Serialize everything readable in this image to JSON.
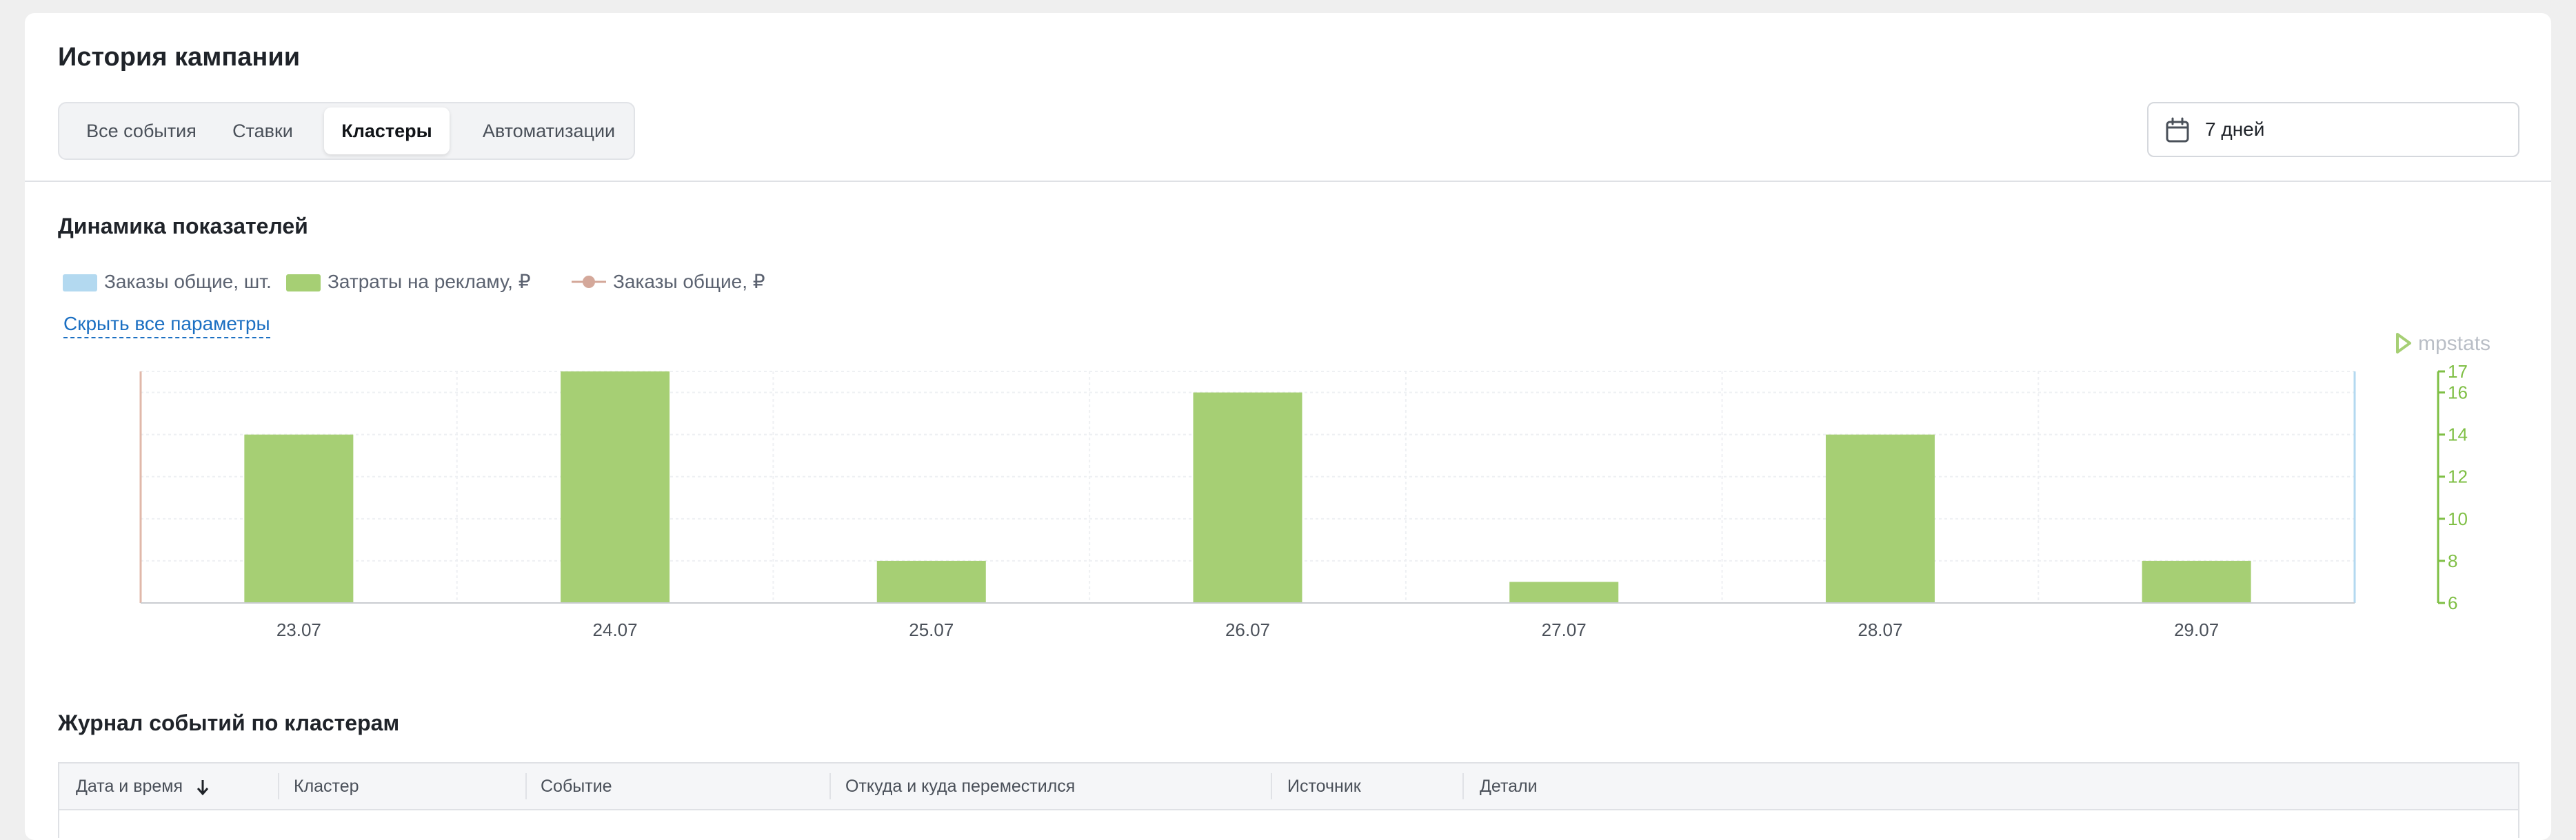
{
  "header": {
    "title": "История кампании"
  },
  "tabs": [
    {
      "label": "Все события",
      "active": false
    },
    {
      "label": "Ставки",
      "active": false
    },
    {
      "label": "Кластеры",
      "active": true
    },
    {
      "label": "Автоматизации",
      "active": false
    }
  ],
  "period": {
    "label": "7 дней"
  },
  "metrics": {
    "title": "Динамика показателей",
    "legend": [
      {
        "label": "Заказы общие, шт.",
        "color": "#b3d9f0"
      },
      {
        "label": "Затраты на рекламу, ₽",
        "color": "#a6cf74"
      },
      {
        "label": "Заказы общие, ₽",
        "color": "#d4a89a"
      }
    ],
    "hide_link": "Скрыть все параметры",
    "watermark": "mpstats"
  },
  "chart_data": {
    "type": "bar",
    "categories": [
      "23.07",
      "24.07",
      "25.07",
      "26.07",
      "27.07",
      "28.07",
      "29.07"
    ],
    "series": [
      {
        "name": "Затраты на рекламу, ₽",
        "values": [
          14,
          17,
          8,
          16,
          7,
          14,
          8
        ],
        "color": "#a6cf74",
        "axis": "right"
      }
    ],
    "y_right": {
      "min": 6,
      "max": 17,
      "ticks": [
        "17",
        "16",
        "14",
        "12",
        "10",
        "8",
        "6"
      ],
      "color": "#7fbf45"
    },
    "grid": true
  },
  "journal": {
    "title": "Журнал событий по кластерам",
    "columns": [
      "Дата и время",
      "Кластер",
      "Событие",
      "Откуда и куда переместился",
      "Источник",
      "Детали"
    ]
  }
}
